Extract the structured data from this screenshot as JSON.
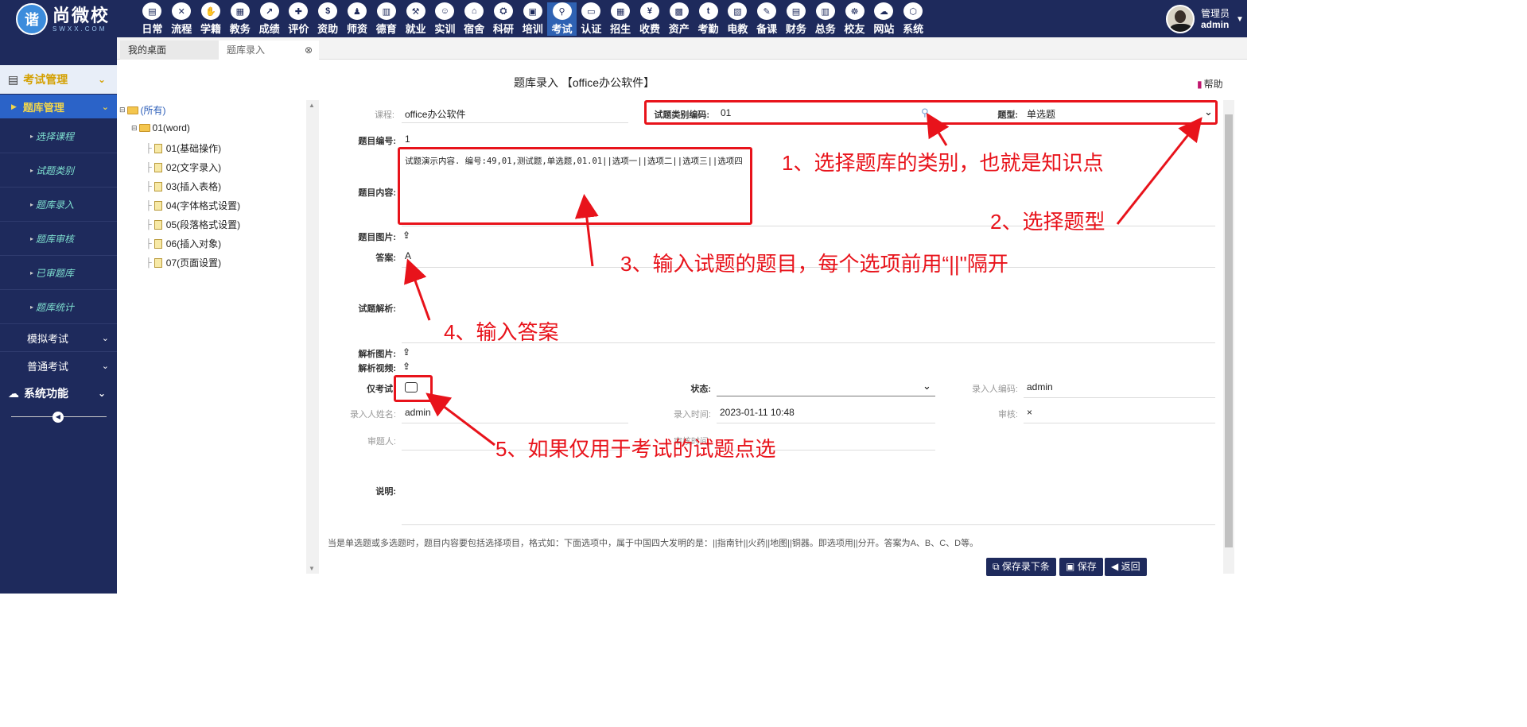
{
  "header": {
    "logo_cn": "尚微校",
    "logo_en": "SWXX.COM",
    "logo_mark": "谐",
    "nav": [
      "日常",
      "流程",
      "学籍",
      "教务",
      "成绩",
      "评价",
      "资助",
      "师资",
      "德育",
      "就业",
      "实训",
      "宿舍",
      "科研",
      "培训",
      "考试",
      "认证",
      "招生",
      "收费",
      "资产",
      "考勤",
      "电教",
      "备课",
      "财务",
      "总务",
      "校友",
      "网站",
      "系统"
    ],
    "active_nav": "考试",
    "user_role": "管理员",
    "user_name": "admin"
  },
  "tabs": [
    "我的桌面",
    "题库录入"
  ],
  "sidebar": {
    "section1": "考试管理",
    "group1": "题库管理",
    "leaves": [
      "选择课程",
      "试题类别",
      "题库录入",
      "题库审核",
      "已审题库",
      "题库统计"
    ],
    "group2": "模拟考试",
    "group3": "普通考试",
    "section2": "系统功能"
  },
  "page": {
    "title": "题库录入 【office办公软件】",
    "help": "帮助"
  },
  "tree": {
    "root": "(所有)",
    "folder": "01(word)",
    "items": [
      "01(基础操作)",
      "02(文字录入)",
      "03(插入表格)",
      "04(字体格式设置)",
      "05(段落格式设置)",
      "06(插入对象)",
      "07(页面设置)"
    ]
  },
  "form": {
    "course_label": "课程:",
    "course_value": "office办公软件",
    "category_label": "试题类别编码:",
    "category_value": "01",
    "type_label": "题型:",
    "type_value": "单选题",
    "qnum_label": "题目编号:",
    "qnum_value": "1",
    "content_label": "题目内容:",
    "content_value": "试题演示内容. 编号:49,01,测试题,单选题,01.01||选项一||选项二||选项三||选项四",
    "image_label": "题目图片:",
    "answer_label": "答案:",
    "answer_value": "A",
    "analysis_label": "试题解析:",
    "analysis_image_label": "解析图片:",
    "analysis_video_label": "解析视频:",
    "exam_only_label": "仅考试",
    "status_label": "状态:",
    "status_value": "",
    "entry_code_label": "录入人编码:",
    "entry_code_value": "admin",
    "entry_name_label": "录入人姓名:",
    "entry_name_value": "admin",
    "entry_time_label": "录入时间:",
    "entry_time_value": "2023-01-11 10:48",
    "review_label": "审核:",
    "review_value": "×",
    "reviewer_label": "审题人:",
    "review_time_label": "审核时间:",
    "desc_label": "说明:"
  },
  "note": "当是单选题或多选题时，题目内容要包括选择项目，格式如：下面选项中，属于中国四大发明的是：||指南针||火药||地图||铜器。即选项用||分开。答案为A、B、C、D等。",
  "buttons": {
    "save_next": "保存录下条",
    "save": "保存",
    "back": "返回"
  },
  "annotations": [
    "1、选择题库的类别，也就是知识点",
    "2、选择题型",
    "3、输入试题的题目，每个选项前用“||\"隔开",
    "4、输入答案",
    "5、如果仅用于考试的试题点选"
  ],
  "colors": {
    "nav_bg": "#1e2a5c",
    "annotation": "#e8131b",
    "active_nav": "#2f62b3",
    "leaf_text": "#7fe0d0"
  }
}
